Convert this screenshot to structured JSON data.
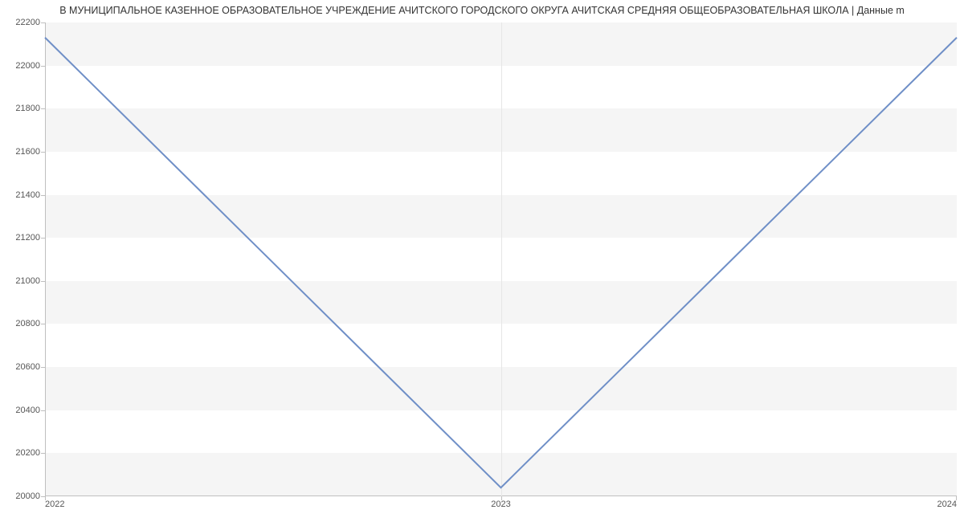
{
  "title": "В МУНИЦИПАЛЬНОЕ КАЗЕННОЕ ОБРАЗОВАТЕЛЬНОЕ УЧРЕЖДЕНИЕ АЧИТСКОГО ГОРОДСКОГО ОКРУГА АЧИТСКАЯ СРЕДНЯЯ ОБЩЕОБРАЗОВАТЕЛЬНАЯ ШКОЛА | Данные m",
  "chart_data": {
    "type": "line",
    "x": [
      2022,
      2023,
      2024
    ],
    "values": [
      22130,
      20040,
      22130
    ],
    "xticks": [
      "2022",
      "2023",
      "2024"
    ],
    "yticks": [
      20000,
      20200,
      20400,
      20600,
      20800,
      21000,
      21200,
      21400,
      21600,
      21800,
      22000,
      22200
    ],
    "ylim": [
      20000,
      22200
    ],
    "line_color": "#6f8fc7"
  },
  "yticklabels": {
    "0": "20000",
    "1": "20200",
    "2": "20400",
    "3": "20600",
    "4": "20800",
    "5": "21000",
    "6": "21200",
    "7": "21400",
    "8": "21600",
    "9": "21800",
    "10": "22000",
    "11": "22200"
  },
  "xticklabels": {
    "0": "2022",
    "1": "2023",
    "2": "2024"
  }
}
